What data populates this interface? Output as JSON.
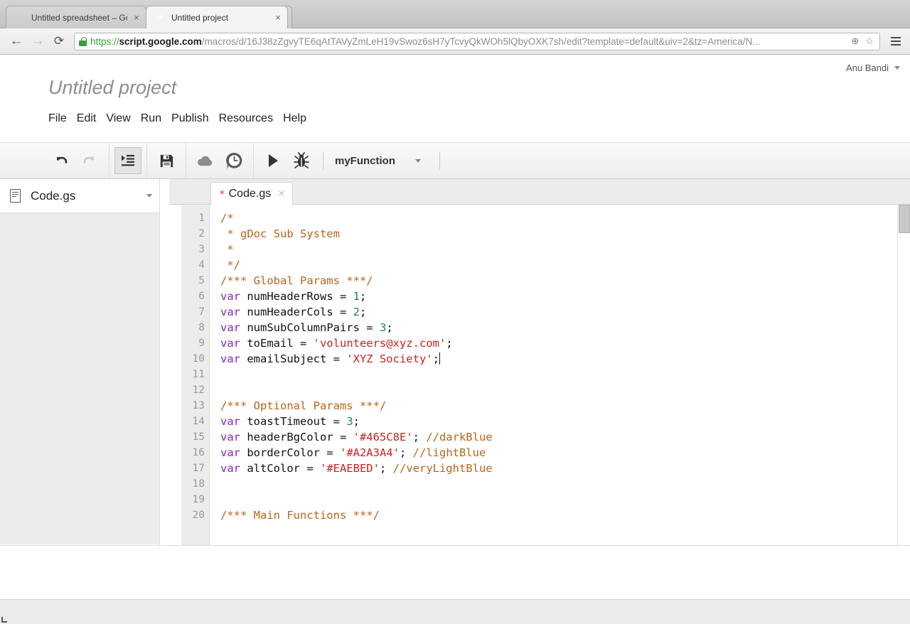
{
  "browser": {
    "tabs": [
      {
        "title": "Untitled spreadsheet – Goo",
        "icon": "sheets-icon",
        "active": false,
        "close_label": "×"
      },
      {
        "title": "Untitled project",
        "icon": "apps-script-icon",
        "active": true,
        "close_label": "×"
      }
    ],
    "nav": {
      "back_glyph": "←",
      "forward_glyph": "→",
      "reload_glyph": "⟳"
    },
    "omnibox": {
      "scheme": "https://",
      "host": "script.google.com",
      "path": "/macros/d/16J38zZgvyTE6qAtTAVyZmLeH19vSwoz6sH7yTcvyQkWOh5lQbyOXK7sh/edit?template=default&uiv=2&tz=America/N...",
      "zoom_glyph": "⊕",
      "bookmark_glyph": "☆",
      "lock_icon": "lock-icon"
    }
  },
  "app": {
    "user": {
      "name": "Anu Bandi"
    },
    "project_title": "Untitled project",
    "menubar": [
      {
        "label": "File"
      },
      {
        "label": "Edit"
      },
      {
        "label": "View"
      },
      {
        "label": "Run"
      },
      {
        "label": "Publish"
      },
      {
        "label": "Resources"
      },
      {
        "label": "Help"
      }
    ],
    "toolbar": {
      "undo": "undo-icon",
      "redo": "redo-icon",
      "indent": "indent-icon",
      "save": "save-icon",
      "publish": "cloud-upload-icon",
      "history": "clock-icon",
      "run": "run-icon",
      "debug": "bug-icon",
      "function_name": "myFunction"
    },
    "sidebar": {
      "file": {
        "name": "Code.gs",
        "icon": "script-file-icon",
        "menu_caret": "chevron-down-icon"
      }
    },
    "editor": {
      "tab": {
        "dirty_marker": "*",
        "label": "Code.gs",
        "close_label": "×"
      },
      "lines": [
        {
          "n": "1",
          "tokens": [
            {
              "t": "comment",
              "v": "/*"
            }
          ]
        },
        {
          "n": "2",
          "tokens": [
            {
              "t": "comment",
              "v": " * gDoc Sub System"
            }
          ]
        },
        {
          "n": "3",
          "tokens": [
            {
              "t": "comment",
              "v": " *"
            }
          ]
        },
        {
          "n": "4",
          "tokens": [
            {
              "t": "comment",
              "v": " */"
            }
          ]
        },
        {
          "n": "5",
          "tokens": [
            {
              "t": "comment",
              "v": "/*** Global Params ***/"
            }
          ]
        },
        {
          "n": "6",
          "tokens": [
            {
              "t": "keyword",
              "v": "var"
            },
            {
              "t": "plain",
              "v": " numHeaderRows = "
            },
            {
              "t": "number",
              "v": "1"
            },
            {
              "t": "plain",
              "v": ";"
            }
          ]
        },
        {
          "n": "7",
          "tokens": [
            {
              "t": "keyword",
              "v": "var"
            },
            {
              "t": "plain",
              "v": " numHeaderCols = "
            },
            {
              "t": "number",
              "v": "2"
            },
            {
              "t": "plain",
              "v": ";"
            }
          ]
        },
        {
          "n": "8",
          "tokens": [
            {
              "t": "keyword",
              "v": "var"
            },
            {
              "t": "plain",
              "v": " numSubColumnPairs = "
            },
            {
              "t": "number",
              "v": "3"
            },
            {
              "t": "plain",
              "v": ";"
            }
          ]
        },
        {
          "n": "9",
          "tokens": [
            {
              "t": "keyword",
              "v": "var"
            },
            {
              "t": "plain",
              "v": " toEmail = "
            },
            {
              "t": "string",
              "v": "'volunteers@xyz.com'"
            },
            {
              "t": "plain",
              "v": ";"
            }
          ]
        },
        {
          "n": "10",
          "tokens": [
            {
              "t": "keyword",
              "v": "var"
            },
            {
              "t": "plain",
              "v": " emailSubject = "
            },
            {
              "t": "string",
              "v": "'XYZ Society'"
            },
            {
              "t": "plain",
              "v": ";"
            },
            {
              "t": "caret",
              "v": ""
            }
          ]
        },
        {
          "n": "11",
          "tokens": []
        },
        {
          "n": "12",
          "tokens": []
        },
        {
          "n": "13",
          "tokens": [
            {
              "t": "comment",
              "v": "/*** Optional Params ***/"
            }
          ]
        },
        {
          "n": "14",
          "tokens": [
            {
              "t": "keyword",
              "v": "var"
            },
            {
              "t": "plain",
              "v": " toastTimeout = "
            },
            {
              "t": "number",
              "v": "3"
            },
            {
              "t": "plain",
              "v": ";"
            }
          ]
        },
        {
          "n": "15",
          "tokens": [
            {
              "t": "keyword",
              "v": "var"
            },
            {
              "t": "plain",
              "v": " headerBgColor = "
            },
            {
              "t": "string",
              "v": "'#465C8E'"
            },
            {
              "t": "plain",
              "v": "; "
            },
            {
              "t": "comment",
              "v": "//darkBlue"
            }
          ]
        },
        {
          "n": "16",
          "tokens": [
            {
              "t": "keyword",
              "v": "var"
            },
            {
              "t": "plain",
              "v": " borderColor = "
            },
            {
              "t": "string",
              "v": "'#A2A3A4'"
            },
            {
              "t": "plain",
              "v": "; "
            },
            {
              "t": "comment",
              "v": "//lightBlue"
            }
          ]
        },
        {
          "n": "17",
          "tokens": [
            {
              "t": "keyword",
              "v": "var"
            },
            {
              "t": "plain",
              "v": " altColor = "
            },
            {
              "t": "string",
              "v": "'#EAEBED'"
            },
            {
              "t": "plain",
              "v": "; "
            },
            {
              "t": "comment",
              "v": "//veryLightBlue"
            }
          ]
        },
        {
          "n": "18",
          "tokens": []
        },
        {
          "n": "19",
          "tokens": []
        },
        {
          "n": "20",
          "tokens": [
            {
              "t": "comment",
              "v": "/*** Main Functions ***/"
            }
          ]
        }
      ]
    }
  },
  "colors": {
    "comment": "#b9651a",
    "keyword": "#8a23c9",
    "number": "#1b8a3f",
    "string": "#c9211e",
    "dirty_marker": "#e8453c",
    "tab_accent": "#3b78e7",
    "lock_green": "#3a9e3a"
  }
}
